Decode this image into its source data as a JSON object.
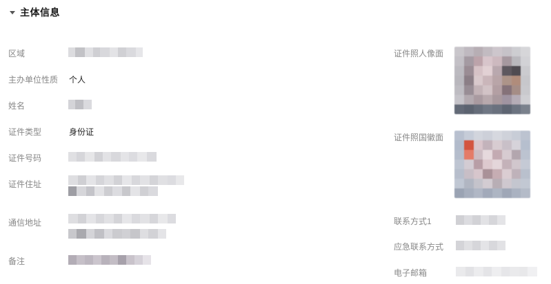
{
  "section": {
    "title": "主体信息",
    "caret_icon": "caret-down-icon"
  },
  "left_fields": [
    {
      "label": "区域",
      "value": ""
    },
    {
      "label": "主办单位性质",
      "value": "个人"
    },
    {
      "label": "姓名",
      "value": ""
    },
    {
      "label": "证件类型",
      "value": "身份证"
    },
    {
      "label": "证件号码",
      "value": ""
    },
    {
      "label": "证件住址",
      "value": ""
    },
    {
      "label": "通信地址",
      "value": ""
    },
    {
      "label": "备注",
      "value": ""
    }
  ],
  "right_fields": [
    {
      "label": "证件照人像面"
    },
    {
      "label": "证件照国徽面"
    },
    {
      "label": "联系方式1",
      "value": ""
    },
    {
      "label": "应急联系方式",
      "value": ""
    },
    {
      "label": "电子邮箱",
      "value": ""
    }
  ],
  "colors": {
    "label": "#888888",
    "value": "#222222",
    "title": "#1a1a1a",
    "redacted": "#d5d5d8"
  }
}
